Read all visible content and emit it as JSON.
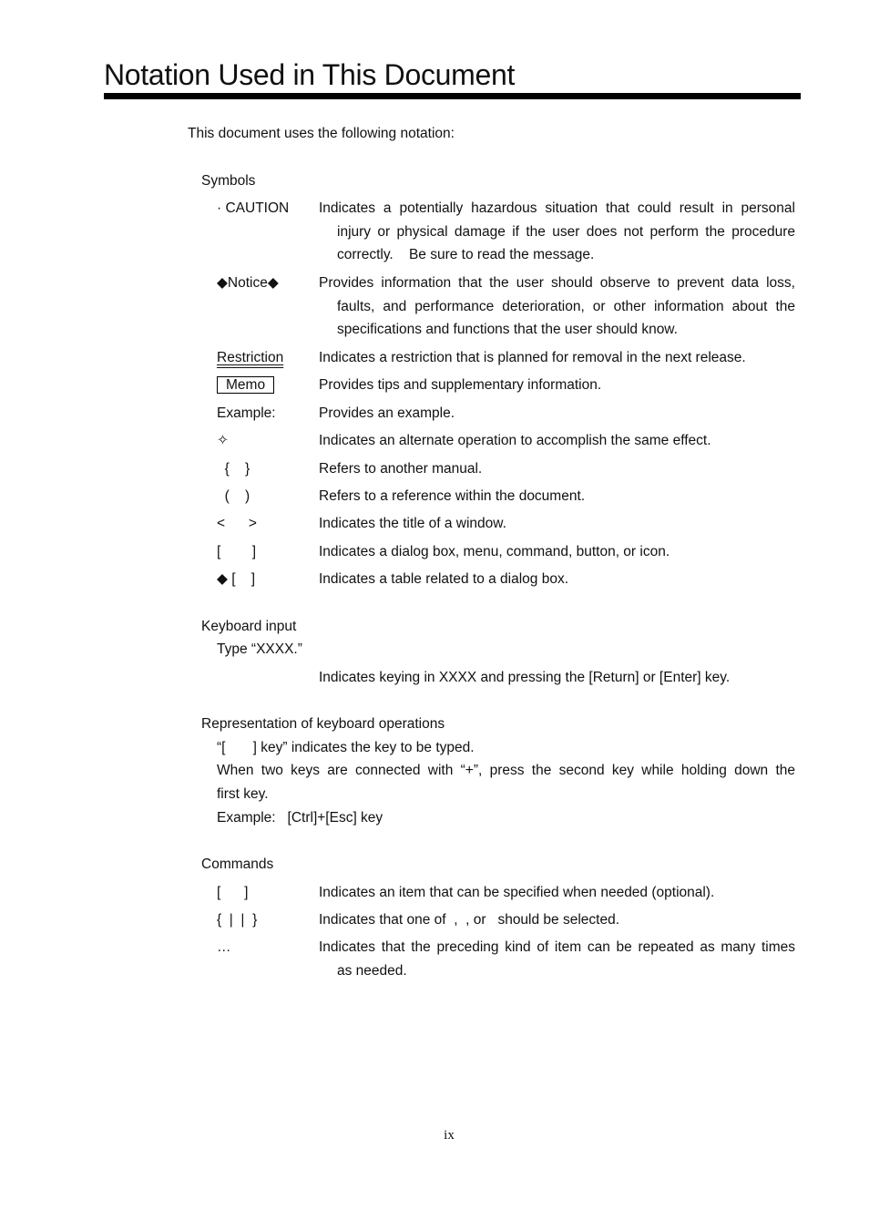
{
  "page": {
    "title": "Notation Used in This Document",
    "intro": "This document uses the following notation:",
    "page_number": "ix"
  },
  "symbols": {
    "heading": "Symbols",
    "items": [
      {
        "symbol": "· CAUTION",
        "lines": [
          "Indicates a potentially hazardous situation that could result in personal",
          "injury or physical damage if the user does not perform the procedure",
          "correctly.    Be sure to read the message."
        ]
      },
      {
        "symbol": "◆Notice◆",
        "lines": [
          "Provides information that the user should observe to prevent data loss,",
          "faults, and performance deterioration, or other information about the",
          "specifications and functions that the user should know."
        ]
      },
      {
        "symbol": "Restriction",
        "lines": [
          "Indicates a restriction that is planned for removal in the next release."
        ]
      },
      {
        "symbol": "Memo",
        "lines": [
          "Provides tips and supplementary information."
        ]
      },
      {
        "symbol": "Example:",
        "lines": [
          "Provides an example."
        ]
      },
      {
        "symbol": "✧",
        "lines": [
          "Indicates an alternate operation to accomplish the same effect."
        ]
      },
      {
        "symbol": "  {    }",
        "lines": [
          "Refers to another manual."
        ]
      },
      {
        "symbol": "  (    )",
        "lines": [
          "Refers to a reference within the document."
        ]
      },
      {
        "symbol": "<      >",
        "lines": [
          "Indicates the title of a window."
        ]
      },
      {
        "symbol": "[        ]",
        "lines": [
          "Indicates a dialog box, menu, command, button, or icon."
        ]
      },
      {
        "symbol": "◆ [    ]",
        "lines": [
          "Indicates a table related to a dialog box."
        ]
      }
    ]
  },
  "keyboard_input": {
    "heading": "Keyboard input",
    "example": "Type “XXXX.”",
    "description": "Indicates keying in XXXX and pressing the [Return] or [Enter] key."
  },
  "keyboard_ops": {
    "heading": "Representation of keyboard operations",
    "line1": "“[       ] key” indicates the key to be typed.",
    "line2a": "When two keys are connected with “+”, press the second key while holding down the",
    "line2b": "first key.",
    "example": "Example:   [Ctrl]+[Esc] key"
  },
  "commands": {
    "heading": "Commands",
    "items": [
      {
        "symbol": "[      ]",
        "lines": [
          "Indicates an item that can be specified when needed (optional)."
        ]
      },
      {
        "symbol": "{  |  |  }",
        "lines": [
          "Indicates that one of  ,  , or   should be selected."
        ]
      },
      {
        "symbol": "…",
        "lines": [
          "Indicates that the preceding kind of item can be repeated as many times",
          "as needed."
        ]
      }
    ]
  }
}
